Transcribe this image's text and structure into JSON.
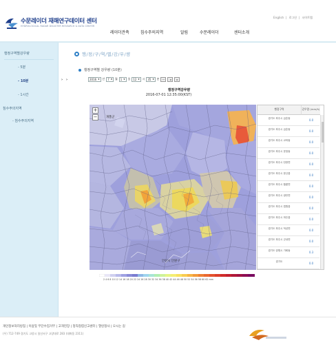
{
  "header": {
    "logo_title": "수문레이더 재해연구데이터 센터",
    "logo_subtitle": "HYDROLOGICAL RADAR DISASTER RESEARCH & DATA CENTER",
    "util_links": [
      "English",
      "|",
      "로그인",
      "|",
      "사이트맵"
    ],
    "nav": [
      "레이더관측",
      "침수주의지역",
      "알림",
      "수문레이더",
      "센터소개"
    ]
  },
  "sidebar": {
    "section1": "행정구역별강우량",
    "items1": [
      "- 5분",
      "- 10분",
      "- 1시간"
    ],
    "section2": "침수주의지역",
    "items2": [
      "- 침수주의지역"
    ]
  },
  "page": {
    "title": "행/정/구/역/별/강/우/량",
    "section_title": "행정구역별 강우량 (10분)"
  },
  "controls": {
    "year": "2016",
    "year_unit": "년",
    "month": "7",
    "month_unit": "월",
    "day": "1",
    "day_unit": "일",
    "hour": "12",
    "hour_unit": "시",
    "minute": "35",
    "minute_unit": "분",
    "btn_minus": "—",
    "btn_prev": "◂",
    "btn_next": "▸"
  },
  "map": {
    "title": "행정구역강우량",
    "timestamp": "2016-07-01 12:35:00(KST)",
    "label_north": "개풍군",
    "label_south": "안산시 단원구",
    "zoom_in": "+",
    "zoom_out": "−"
  },
  "table": {
    "col_region": "행정구역",
    "col_rain": "강우량 (mm/h)",
    "rows": [
      {
        "name": "경기도 파주시 금촌동",
        "value": "0.0"
      },
      {
        "name": "경기도 파주시 금촌동",
        "value": "0.0"
      },
      {
        "name": "경기도 파주시 교하동",
        "value": "0.0"
      },
      {
        "name": "경기도 파주시 운정동",
        "value": "0.0"
      },
      {
        "name": "경기도 파주시 탄현면",
        "value": "0.0"
      },
      {
        "name": "경기도 파주시 문산읍",
        "value": "0.0"
      },
      {
        "name": "경기도 파주시 월롱면",
        "value": "0.0"
      },
      {
        "name": "경기도 파주시 광탄면",
        "value": "0.0"
      },
      {
        "name": "경기도 파주시 법원읍",
        "value": "0.0"
      },
      {
        "name": "경기도 파주시 파주읍",
        "value": "0.0"
      },
      {
        "name": "경기도 파주시 적성면",
        "value": "0.0"
      },
      {
        "name": "경기도 파주시 군내면",
        "value": "0.0"
      },
      {
        "name": "경기도 양평시 가회동",
        "value": "0.3"
      },
      {
        "name": "경기도",
        "value": "0.0"
      }
    ]
  },
  "legend": {
    "ticks": "2  4  6  8  10 12 14 16 18 20 22 24 26 28 30 32 34 36 38 40 42 44 46 48 50 52 54 56 58 60 62 mm"
  },
  "footer": {
    "links": "개인정보처리방침 | 이용및 무단수집거부 | 고객헌장 | 정직청렴신고센터 | 열린청사 | 오시는 길",
    "address": "(우) 712-749 경기도 고양시 일산서구 고양대로 283 (대화동 2311)"
  },
  "colors": {
    "brand_blue": "#1f3f8c",
    "accent_blue": "#2d7fc6",
    "sidebar_bg": "#dbeef7",
    "map_base": "#9b9ad6"
  }
}
